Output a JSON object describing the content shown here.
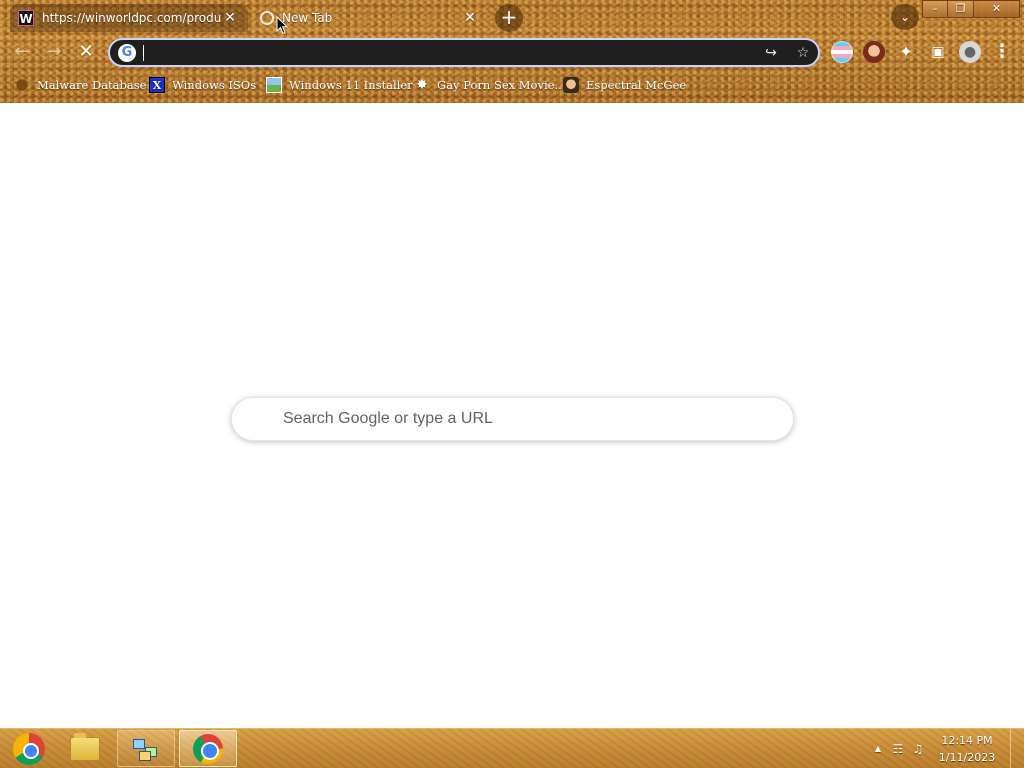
{
  "tabs": [
    {
      "title": "https://winworldpc.com/product/",
      "favicon": "W",
      "active": true
    },
    {
      "title": "New Tab",
      "active": false
    }
  ],
  "tab_close_glyph": "✕",
  "new_tab_glyph": "+",
  "tab_search_glyph": "⌄",
  "window_controls": {
    "minimize": "–",
    "restore": "❐",
    "close": "✕"
  },
  "toolbar": {
    "back_glyph": "←",
    "forward_glyph": "→",
    "stop_glyph": "✕",
    "omnibox_value": "",
    "omnibox_badge": "G",
    "share_glyph": "↪",
    "star_glyph": "☆"
  },
  "extensions": {
    "puzzle_glyph": "✦",
    "panel_glyph": "▣",
    "profile_glyph": "●",
    "menu_glyph": "⋮"
  },
  "bookmarks": [
    {
      "label": "Malware Database",
      "icon": "malware-icon"
    },
    {
      "label": "Windows ISOs",
      "icon": "x-icon",
      "glyph": "X"
    },
    {
      "label": "Windows 11 Installer",
      "icon": "landscape-icon"
    },
    {
      "label": "Gay Porn Sex Movie...",
      "icon": "disk-icon",
      "glyph": "✸"
    },
    {
      "label": "Espectral McGee",
      "icon": "face-icon"
    }
  ],
  "ntp": {
    "search_placeholder": "Search Google or type a URL"
  },
  "taskbar": {
    "apps": [
      "start-orb",
      "file-explorer",
      "network-app",
      "chrome"
    ],
    "tray": {
      "up_arrow": "▲",
      "network": "☶",
      "volume": "♫"
    },
    "time": "12:14 PM",
    "date": "1/11/2023"
  }
}
